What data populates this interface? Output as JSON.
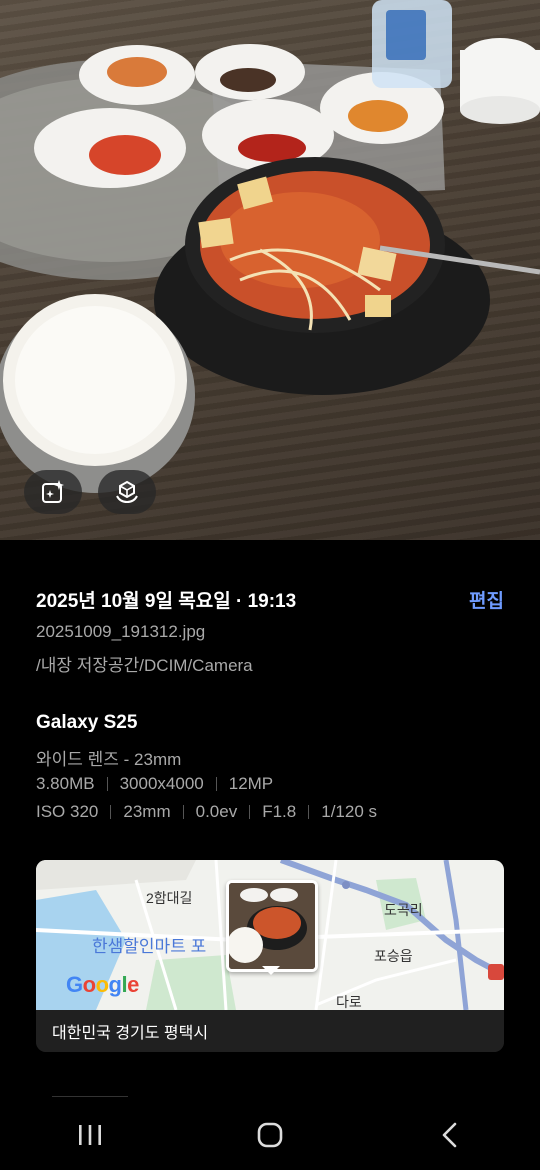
{
  "photo": {
    "ai_edit_button": "sparkle-edit-icon",
    "object_button": "cube-hand-icon"
  },
  "info": {
    "datetime": "2025년 10월 9일 목요일 · 19:13",
    "edit_label": "편집",
    "filename": "20251009_191312.jpg",
    "path": "/내장 저장공간/DCIM/Camera"
  },
  "camera": {
    "device": "Galaxy S25",
    "lens": "와이드 렌즈 - 23mm",
    "file_size": "3.80MB",
    "resolution": "3000x4000",
    "megapixels": "12MP",
    "iso": "ISO 320",
    "focal_length": "23mm",
    "exposure": "0.0ev",
    "aperture": "F1.8",
    "shutter": "1/120 s"
  },
  "map": {
    "labels": {
      "street": "2함대길",
      "mart": "한샘할인마트 포",
      "dogokri": "도곡리",
      "poseungeup": "포승읍",
      "road": "다로"
    },
    "google": [
      "G",
      "o",
      "o",
      "g",
      "l",
      "e"
    ],
    "google_colors": [
      "#4285F4",
      "#EA4335",
      "#FBBC05",
      "#4285F4",
      "#34A853",
      "#EA4335"
    ],
    "location": "대한민국 경기도 평택시"
  },
  "navbar": {
    "recents": "recents-icon",
    "home": "home-icon",
    "back": "back-icon"
  }
}
